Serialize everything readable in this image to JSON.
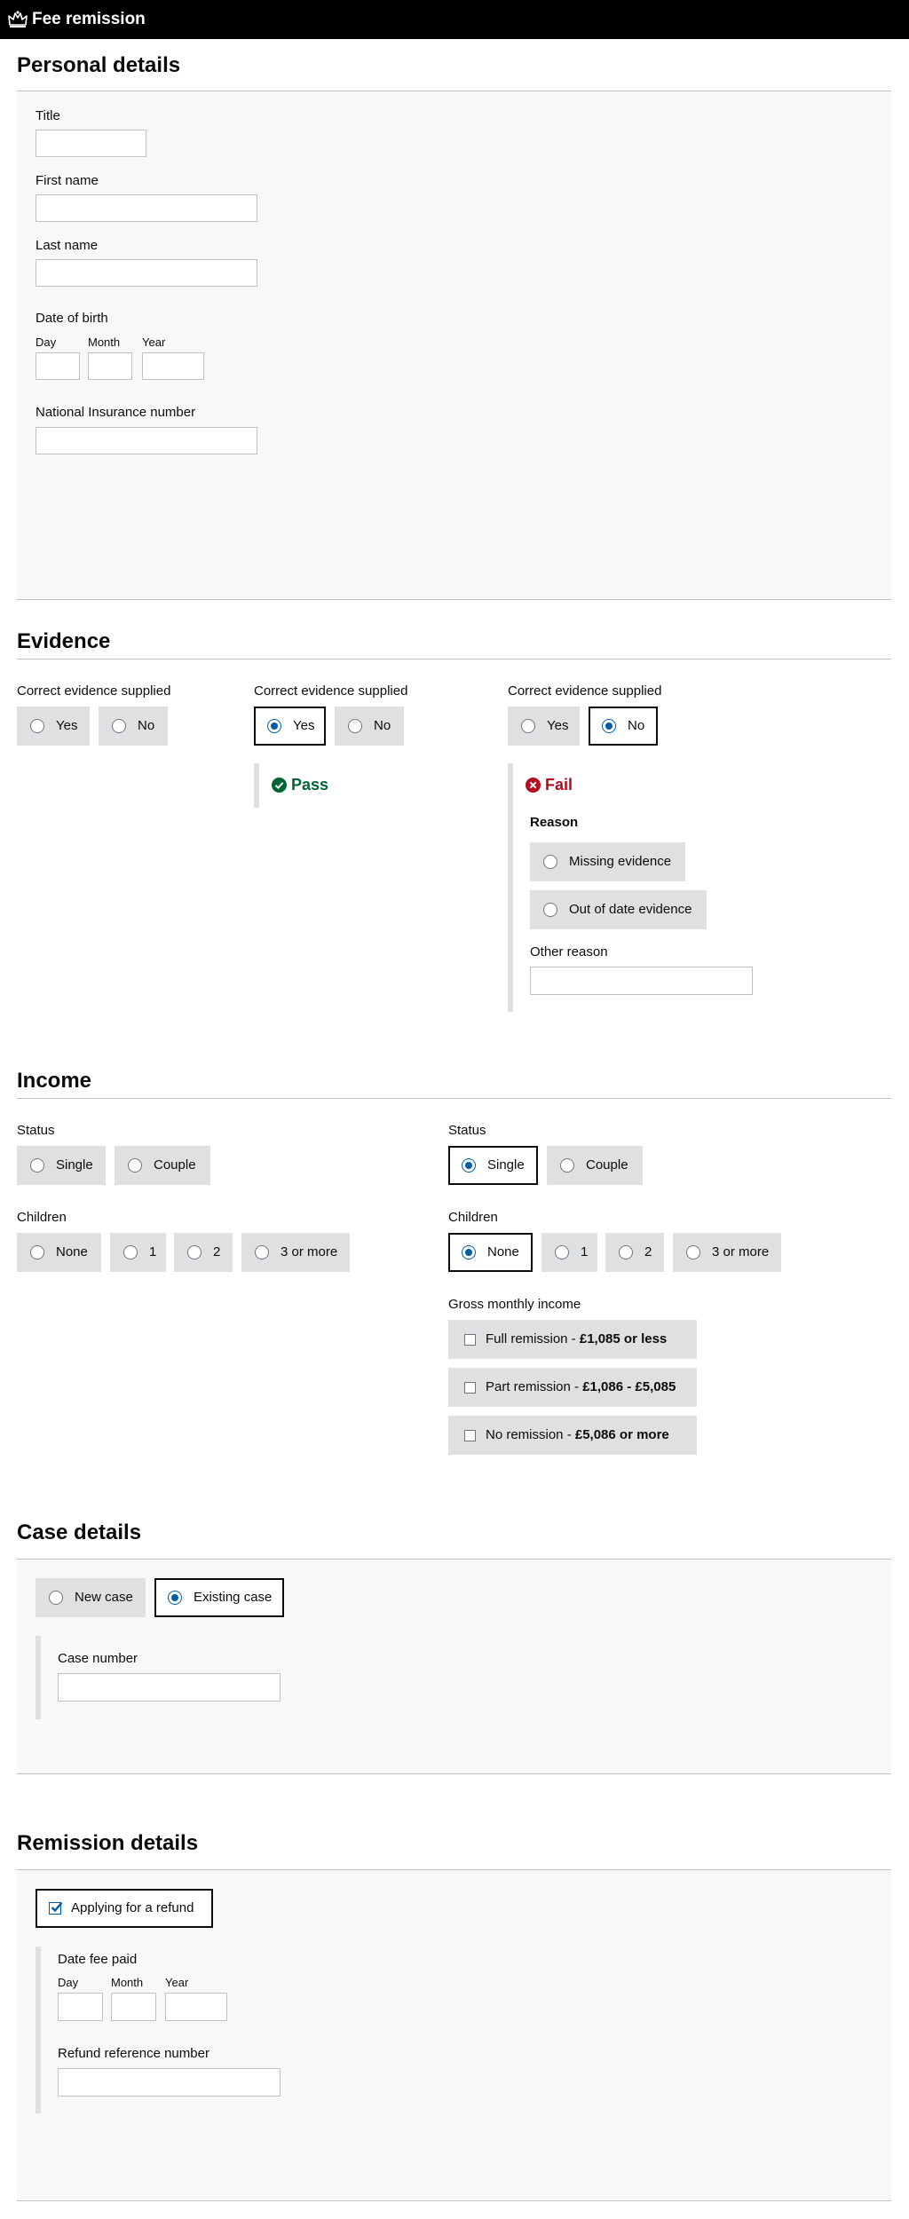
{
  "header": {
    "title": "Fee remission"
  },
  "personal": {
    "heading": "Personal details",
    "title_label": "Title",
    "first_name_label": "First name",
    "last_name_label": "Last name",
    "dob_label": "Date of birth",
    "day": "Day",
    "month": "Month",
    "year": "Year",
    "ni_label": "National Insurance number"
  },
  "evidence": {
    "heading": "Evidence",
    "question": "Correct evidence supplied",
    "yes": "Yes",
    "no": "No",
    "pass": "Pass",
    "fail": "Fail",
    "reason_label": "Reason",
    "missing": "Missing evidence",
    "out_of_date": "Out of date evidence",
    "other_reason": "Other reason"
  },
  "income": {
    "heading": "Income",
    "status_label": "Status",
    "single": "Single",
    "couple": "Couple",
    "children_label": "Children",
    "none": "None",
    "one": "1",
    "two": "2",
    "three": "3 or more",
    "gross_label": "Gross monthly income",
    "full_prefix": "Full remission - ",
    "full_value": "£1,085 or less",
    "part_prefix": "Part remission - ",
    "part_value": "£1,086 - £5,085",
    "no_prefix": "No remission - ",
    "no_value": "£5,086 or more"
  },
  "case": {
    "heading": "Case details",
    "new_case": "New case",
    "existing_case": "Existing case",
    "case_number": "Case number"
  },
  "remission": {
    "heading": "Remission details",
    "refund": "Applying for a refund",
    "date_fee_paid": "Date fee paid",
    "day": "Day",
    "month": "Month",
    "year": "Year",
    "refund_ref": "Refund reference number"
  },
  "colors": {
    "link_blue": "#005ea5",
    "pass_green": "#006435",
    "fail_red": "#b10e1e",
    "option_grey": "#dee0e2"
  },
  "icons": {
    "crown": "crown-icon",
    "pass": "check-circle-icon",
    "fail": "cross-circle-icon",
    "tick": "checkmark-icon"
  }
}
